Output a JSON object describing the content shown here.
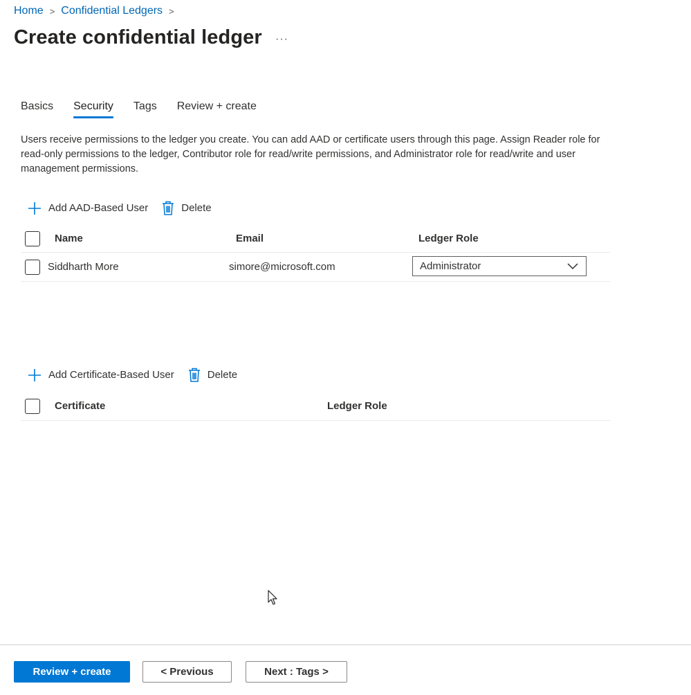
{
  "breadcrumb": {
    "home": "Home",
    "ledgers": "Confidential Ledgers"
  },
  "page": {
    "title": "Create confidential ledger",
    "more": "···"
  },
  "tabs": [
    {
      "label": "Basics"
    },
    {
      "label": "Security"
    },
    {
      "label": "Tags"
    },
    {
      "label": "Review + create"
    }
  ],
  "description": "Users receive permissions to the ledger you create. You can add AAD or certificate users through this page. Assign Reader role for read-only permissions to the ledger, Contributor role for read/write permissions, and Administrator role for read/write and user management permissions.",
  "aad": {
    "add_label": "Add AAD-Based User",
    "delete_label": "Delete",
    "columns": {
      "name": "Name",
      "email": "Email",
      "role": "Ledger Role"
    },
    "rows": [
      {
        "name": "Siddharth More",
        "email": "simore@microsoft.com",
        "role": "Administrator"
      }
    ]
  },
  "cert": {
    "add_label": "Add Certificate-Based User",
    "delete_label": "Delete",
    "columns": {
      "certificate": "Certificate",
      "role": "Ledger Role"
    }
  },
  "footer": {
    "review_create": "Review + create",
    "previous": "< Previous",
    "next": "Next : Tags >"
  },
  "colors": {
    "accent": "#0078d4",
    "link": "#0066b4"
  }
}
